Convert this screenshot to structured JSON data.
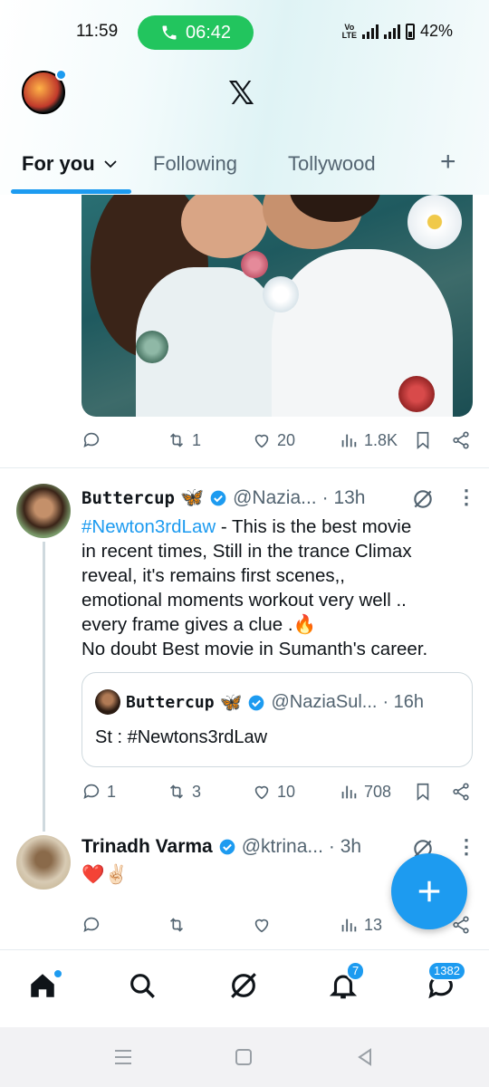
{
  "status_bar": {
    "time": "11:59",
    "call_timer": "06:42",
    "network_label": "Vo LTE",
    "battery": "42%"
  },
  "header": {
    "logo": "𝕏"
  },
  "tabs": [
    {
      "label": "For you",
      "active": true
    },
    {
      "label": "Following",
      "active": false
    },
    {
      "label": "Tollywood",
      "active": false
    }
  ],
  "post1": {
    "actions": {
      "replies": "",
      "reposts": "1",
      "likes": "20",
      "views": "1.8K"
    }
  },
  "post2": {
    "name": "Buttercup",
    "emoji": "🦋",
    "handle": "@Nazia...",
    "time": "· 13h",
    "hashtag": "#Newton3rdLaw",
    "text_lines": [
      " - This is the best movie",
      "in recent times, Still in the trance Climax",
      "reveal, it's remains first scenes,,",
      "emotional moments workout very well ..",
      "every frame gives a clue .🔥",
      "No doubt Best movie in Sumanth's career."
    ],
    "quote": {
      "name": "Buttercup",
      "emoji": "🦋",
      "handle": "@NaziaSul...",
      "time": "· 16h",
      "text": "St : #Newtons3rdLaw"
    },
    "actions": {
      "replies": "1",
      "reposts": "3",
      "likes": "10",
      "views": "708"
    }
  },
  "post3": {
    "name": "Trinadh Varma",
    "handle": "@ktrina...",
    "time": "· 3h",
    "text": "❤️✌🏻",
    "actions": {
      "replies": "",
      "reposts": "",
      "likes": "",
      "views": "13"
    }
  },
  "bottom_nav": {
    "notifications_badge": "7",
    "messages_badge": "1382"
  },
  "colors": {
    "accent": "#1d9bf0",
    "call_green": "#22c55e",
    "muted": "#536471"
  }
}
